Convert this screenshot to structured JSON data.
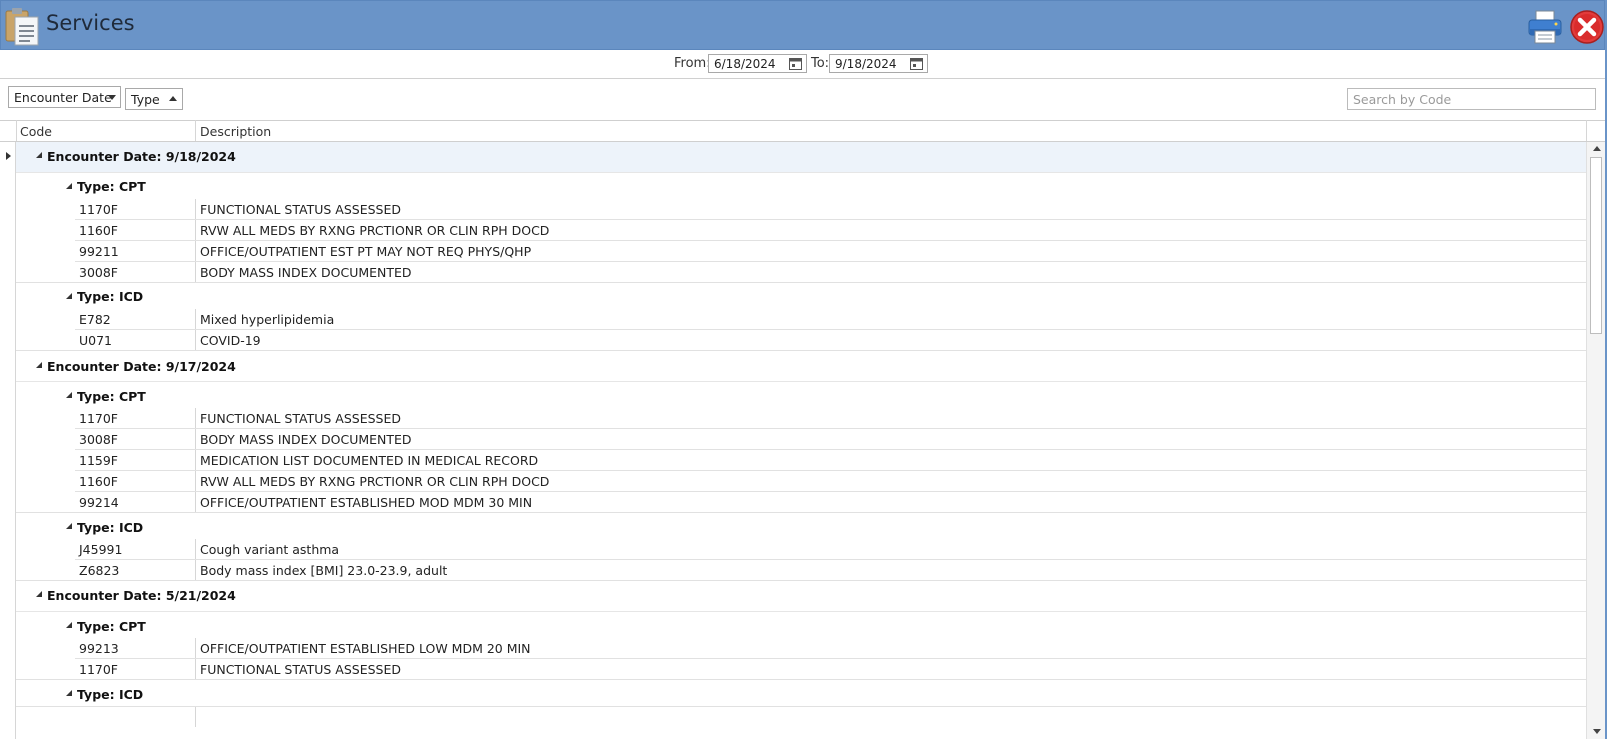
{
  "window": {
    "title": "Services",
    "title_bar_color": "#6a94c8"
  },
  "date_range": {
    "from_label": "From:",
    "from_value": "6/18/2024",
    "to_label": "To:",
    "to_value": "9/18/2024"
  },
  "grouping": {
    "chips": [
      {
        "label": "Encounter Date",
        "sort": "descending"
      },
      {
        "label": "Type",
        "sort": "ascending"
      }
    ]
  },
  "search": {
    "placeholder": "Search by Code"
  },
  "columns": {
    "code": "Code",
    "description": "Description"
  },
  "groups": [
    {
      "label": "Encounter Date: 9/18/2024",
      "subgroups": [
        {
          "label": "Type: CPT",
          "rows": [
            {
              "code": "1170F",
              "description": "FUNCTIONAL STATUS ASSESSED"
            },
            {
              "code": "1160F",
              "description": "RVW ALL MEDS BY RXNG PRCTIONR OR CLIN RPH DOCD"
            },
            {
              "code": "99211",
              "description": "OFFICE/OUTPATIENT EST PT MAY NOT REQ PHYS/QHP"
            },
            {
              "code": "3008F",
              "description": "BODY MASS INDEX DOCUMENTED"
            }
          ]
        },
        {
          "label": "Type: ICD",
          "rows": [
            {
              "code": "E782",
              "description": "Mixed hyperlipidemia"
            },
            {
              "code": "U071",
              "description": "COVID-19"
            }
          ]
        }
      ]
    },
    {
      "label": "Encounter Date: 9/17/2024",
      "subgroups": [
        {
          "label": "Type: CPT",
          "rows": [
            {
              "code": "1170F",
              "description": "FUNCTIONAL STATUS ASSESSED"
            },
            {
              "code": "3008F",
              "description": "BODY MASS INDEX DOCUMENTED"
            },
            {
              "code": "1159F",
              "description": "MEDICATION LIST DOCUMENTED IN MEDICAL RECORD"
            },
            {
              "code": "1160F",
              "description": "RVW ALL MEDS BY RXNG PRCTIONR OR CLIN RPH DOCD"
            },
            {
              "code": "99214",
              "description": "OFFICE/OUTPATIENT ESTABLISHED MOD MDM 30 MIN"
            }
          ]
        },
        {
          "label": "Type: ICD",
          "rows": [
            {
              "code": "J45991",
              "description": "Cough variant asthma"
            },
            {
              "code": "Z6823",
              "description": "Body mass index [BMI] 23.0-23.9, adult"
            }
          ]
        }
      ]
    },
    {
      "label": "Encounter Date: 5/21/2024",
      "subgroups": [
        {
          "label": "Type: CPT",
          "rows": [
            {
              "code": "99213",
              "description": "OFFICE/OUTPATIENT ESTABLISHED LOW MDM 20 MIN"
            },
            {
              "code": "1170F",
              "description": "FUNCTIONAL STATUS ASSESSED"
            }
          ]
        },
        {
          "label": "Type: ICD",
          "rows": []
        }
      ]
    }
  ]
}
